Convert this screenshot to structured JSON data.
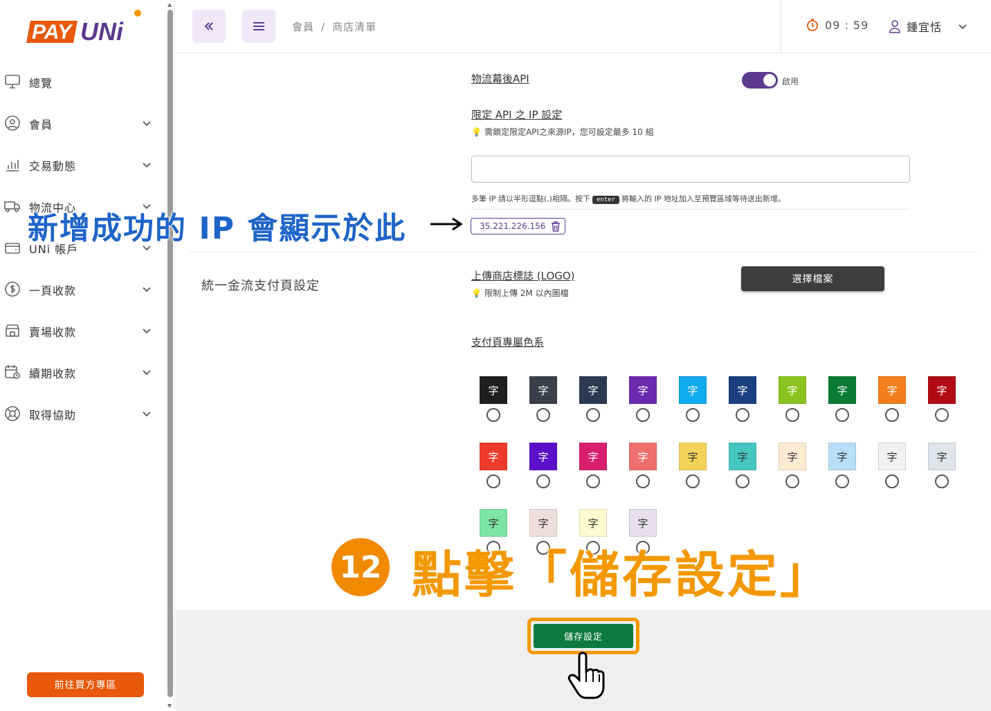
{
  "brand": {
    "logo_text_a": "PAY",
    "logo_text_b": "UNi",
    "orange": "#e8590c",
    "purple": "#5b3a8e"
  },
  "sidebar": {
    "items": [
      {
        "label": "總覽",
        "icon": "monitor-icon",
        "chevron": false
      },
      {
        "label": "會員",
        "icon": "user-circle-icon",
        "chevron": true
      },
      {
        "label": "交易動態",
        "icon": "bar-chart-icon",
        "chevron": true
      },
      {
        "label": "物流中心",
        "icon": "truck-icon",
        "chevron": true
      },
      {
        "label": "UNi 帳戶",
        "icon": "wallet-icon",
        "chevron": true
      },
      {
        "label": "一頁收款",
        "icon": "dollar-circle-icon",
        "chevron": true
      },
      {
        "label": "賣場收款",
        "icon": "store-icon",
        "chevron": true
      },
      {
        "label": "續期收款",
        "icon": "calendar-clock-icon",
        "chevron": true
      },
      {
        "label": "取得協助",
        "icon": "lifebuoy-icon",
        "chevron": true
      }
    ],
    "buyer_button": "前往買方專區"
  },
  "header": {
    "breadcrumb": [
      "會員",
      "商店清單"
    ],
    "breadcrumb_sep": "/",
    "timer": "09 : 59",
    "user_name": "鍾宜恬"
  },
  "form": {
    "logistics_api_label": "物流幕後API",
    "toggle_state": "啟用",
    "toggle_on": true,
    "ip_label": "限定 API 之 IP 設定",
    "ip_hint": "需鎖定限定API之來源IP，您可設定最多 10 組",
    "ip_input_value": "",
    "ip_note_before": "多筆 IP 請以半形逗點(,)相隔。按下",
    "ip_note_key": "enter",
    "ip_note_after": "將輸入的 IP 地址加入至預覽區域等待送出新增。",
    "ip_chip": "35.221.226.156",
    "section_title": "統一金流支付頁設定",
    "logo_label": "上傳商店標誌 (LOGO)",
    "logo_hint": "限制上傳 2M 以內圖檔",
    "file_button": "選擇檔案",
    "theme_label": "支付頁專屬色系",
    "swatch_char": "字",
    "swatch_colors": [
      "#1f1f1f",
      "#3a3f4a",
      "#2b3a52",
      "#6a2bb0",
      "#10aaf0",
      "#1a3f80",
      "#8cc41f",
      "#0b7a34",
      "#f27f1b",
      "#b30b16",
      "#ef3b2c",
      "#5b0fc9",
      "#d91e6e",
      "#ef6f6f",
      "#f5d25a",
      "#45c7c0",
      "#fdebd2",
      "#b8dff5",
      "#f1f1f1",
      "#dfe3ea",
      "#7ee3a6",
      "#f0dede",
      "#fdfbcf",
      "#e5e0ec"
    ],
    "swatch_text_colors": [
      "#fff",
      "#fff",
      "#fff",
      "#fff",
      "#fff",
      "#fff",
      "#fff",
      "#fff",
      "#fff",
      "#fff",
      "#fff",
      "#fff",
      "#fff",
      "#fff",
      "#333",
      "#333",
      "#333",
      "#333",
      "#333",
      "#333",
      "#333",
      "#333",
      "#333",
      "#333"
    ],
    "save_button": "儲存設定"
  },
  "annotations": {
    "ip_callout": "新增成功的 IP 會顯示於此",
    "step_number": "12",
    "step_text": "點擊「儲存設定」"
  }
}
